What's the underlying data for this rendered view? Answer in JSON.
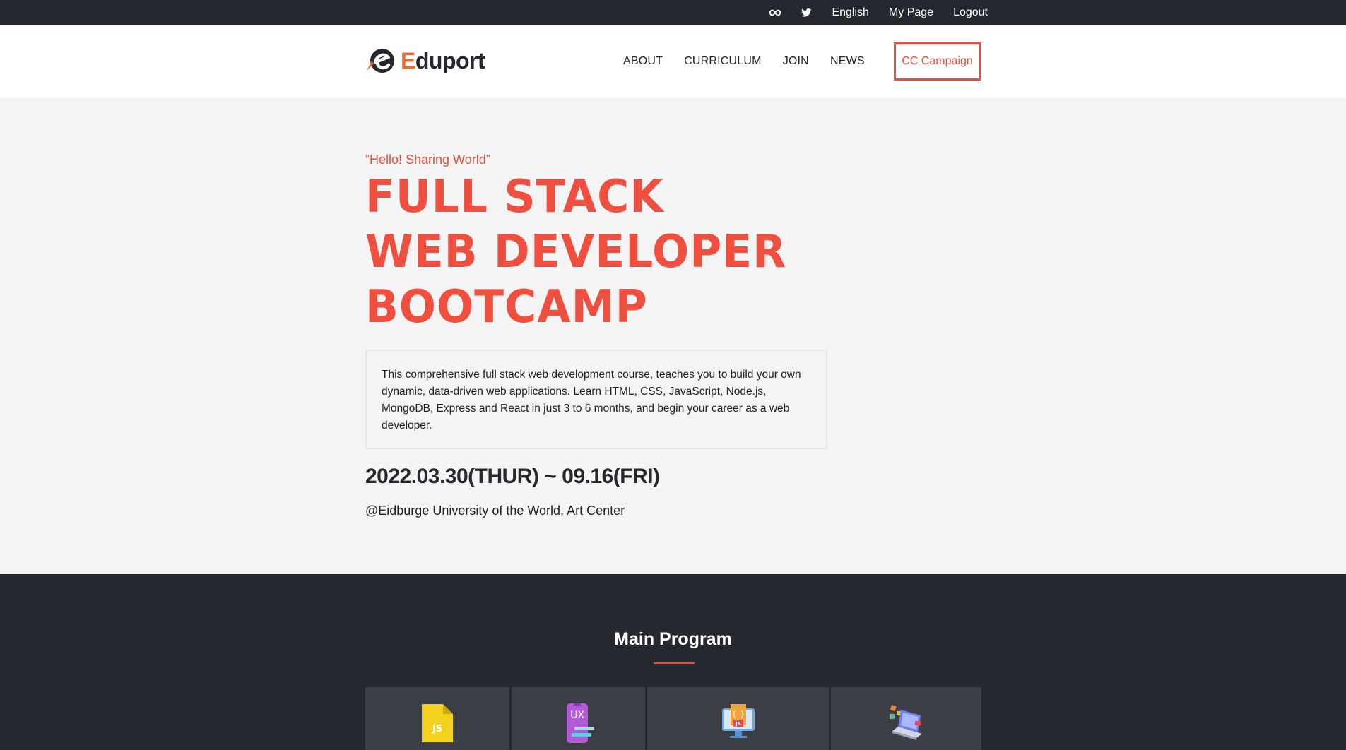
{
  "topbar": {
    "meta_icon": "meta-infinity-icon",
    "twitter_icon": "twitter-bird-icon",
    "language": "English",
    "my_page": "My Page",
    "logout": "Logout"
  },
  "header": {
    "logo_icon": "eduport-e-logo-icon",
    "logo_first_letter": "E",
    "logo_rest": "duport",
    "nav": [
      "ABOUT",
      "CURRICULUM",
      "JOIN",
      "NEWS"
    ],
    "campaign_button": "CC Campaign"
  },
  "hero": {
    "tagline": "“Hello! Sharing World”",
    "headline": [
      "FULL STACK",
      "WEB DEVELOPER",
      "BOOTCAMP"
    ],
    "description": "This comprehensive full stack web development course, teaches you to build your own dynamic, data-driven web applications. Learn HTML, CSS, JavaScript, Node.js, MongoDB, Express and React in just 3 to 6 months, and begin your career as a web developer.",
    "dates": "2022.03.30(THUR) ~ 09.16(FRI)",
    "venue": "@Eidburge University of the World, Art Center"
  },
  "program": {
    "title": "Main Program",
    "cards": [
      {
        "icon": "js-file-icon",
        "label": "JS"
      },
      {
        "icon": "ux-phone-icon",
        "label": "UX"
      },
      {
        "icon": "js-monitor-code-icon",
        "label": "JS"
      },
      {
        "icon": "laptop-design-icon"
      }
    ]
  },
  "colors": {
    "dark": "#262830",
    "accent": "#e94e3c",
    "logo_accent": "#ee6b2b",
    "hero_bg": "#f4f4f4",
    "card_bg": "#3c3e46"
  }
}
